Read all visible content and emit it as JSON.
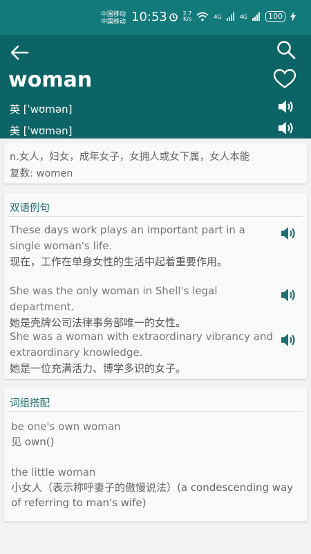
{
  "status_bar": {
    "carrier_line1": "中国移动",
    "carrier_line2": "中国移动",
    "time": "10:53",
    "net_speed_top": "2.7",
    "net_speed_bottom": "K/s",
    "signal1": "4G",
    "signal2": "4G",
    "battery": "100"
  },
  "header": {
    "word": "woman",
    "uk_phonetic": "英 [ˈwʊmən]",
    "us_phonetic": "美 [ˈwʊmən]"
  },
  "definition": {
    "meaning": "n.女人，妇女，成年女子，女拥人或女下属，女人本能",
    "plural": "复数: women"
  },
  "examples": {
    "title": "双语例句",
    "items": [
      {
        "en": "These days work plays an important part in a single woman's life.",
        "cn": "现在，工作在单身女性的生活中起着重要作用。"
      },
      {
        "en": "She was the only woman in Shell's legal department.",
        "cn": "她是壳牌公司法律事务部唯一的女性。"
      },
      {
        "en": "She was a woman with extraordinary vibrancy and extraordinary knowledge.",
        "cn": "她是一位充满活力、博学多识的女子。"
      }
    ]
  },
  "phrases": {
    "title": "词组搭配",
    "items": [
      {
        "en": "be one's own woman",
        "cn": "见 own()"
      },
      {
        "en": "the little woman",
        "cn": "小女人（表示称呼妻子的傲慢说法）(a condescending way of referring to man's wife)"
      }
    ]
  },
  "colors": {
    "status_bar": "#127a7b",
    "header": "#0d6466",
    "accent": "#1f6f71"
  }
}
